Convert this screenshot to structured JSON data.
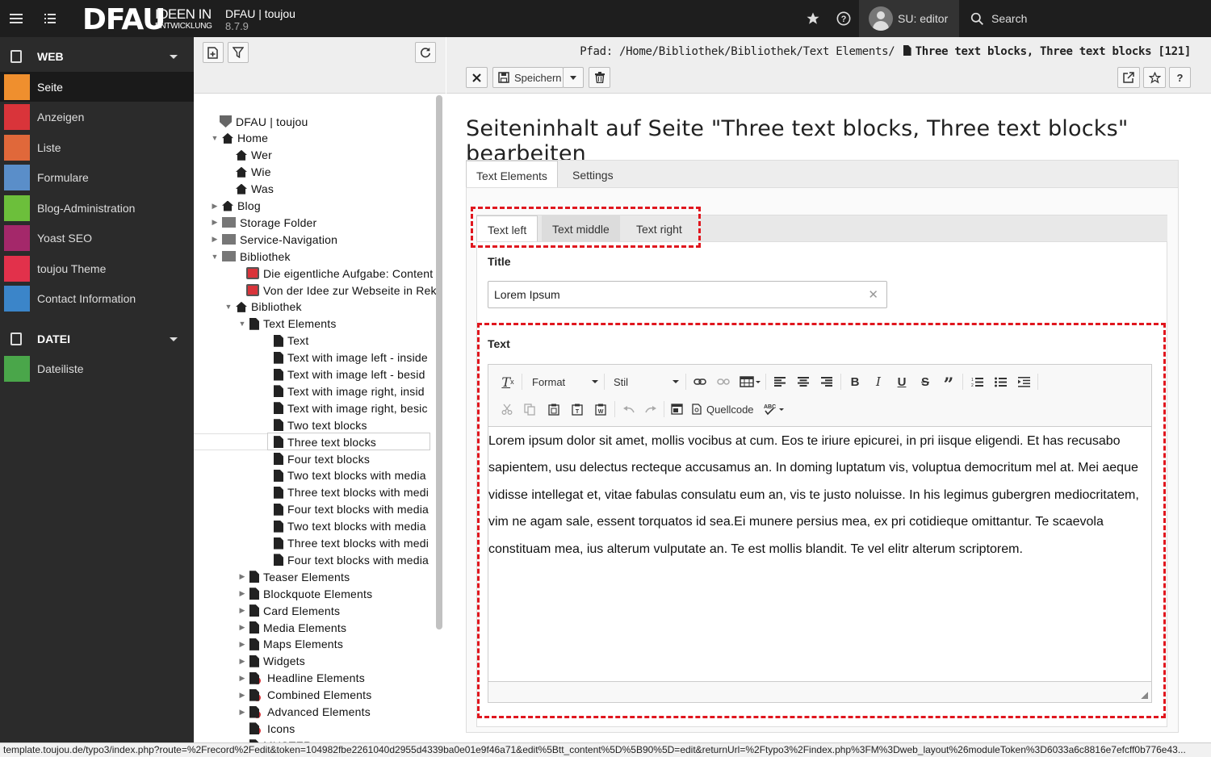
{
  "topbar": {
    "logo_main": "DFAU",
    "logo_line1": "IDEEN IN",
    "logo_line2": "ENTWICKLUNG",
    "site_name": "DFAU | toujou",
    "version": "8.7.9",
    "user_label": "SU: editor",
    "search_label": "Search"
  },
  "sidebar": {
    "groups": [
      {
        "label": "WEB"
      },
      {
        "label": "DATEI"
      }
    ],
    "web_items": [
      {
        "label": "Seite",
        "color": "#ef8f2e"
      },
      {
        "label": "Anzeigen",
        "color": "#d9343a"
      },
      {
        "label": "Liste",
        "color": "#e0683a"
      },
      {
        "label": "Formulare",
        "color": "#5a8ec9"
      },
      {
        "label": "Blog-Administration",
        "color": "#6cbf3b"
      },
      {
        "label": "Yoast SEO",
        "color": "#a4286a"
      },
      {
        "label": "toujou Theme",
        "color": "#e2314b"
      },
      {
        "label": "Contact Information",
        "color": "#3b85c9"
      }
    ],
    "datei_items": [
      {
        "label": "Dateiliste",
        "color": "#4aa64a"
      }
    ]
  },
  "tree": {
    "nodes": [
      {
        "label": "DFAU | toujou",
        "icon": "typo3-root-icon"
      },
      {
        "label": "Home",
        "icon": "home-icon"
      },
      {
        "label": "Wer",
        "icon": "home-icon"
      },
      {
        "label": "Wie",
        "icon": "home-icon"
      },
      {
        "label": "Was",
        "icon": "home-icon"
      },
      {
        "label": "Blog",
        "icon": "home-icon"
      },
      {
        "label": "Storage Folder",
        "icon": "folder-icon"
      },
      {
        "label": "Service-Navigation",
        "icon": "folder-icon"
      },
      {
        "label": "Bibliothek",
        "icon": "folder-icon"
      },
      {
        "label": "Die eigentliche Aufgabe: Content",
        "icon": "shortcut-icon"
      },
      {
        "label": "Von der Idee zur Webseite in Rek",
        "icon": "shortcut-icon"
      },
      {
        "label": "Bibliothek",
        "icon": "home-icon"
      },
      {
        "label": "Text Elements",
        "icon": "page-icon"
      },
      {
        "label": "Text",
        "icon": "page-icon"
      },
      {
        "label": "Text with image left - inside",
        "icon": "page-icon"
      },
      {
        "label": "Text with image left - besid",
        "icon": "page-icon"
      },
      {
        "label": "Text with image right, insid",
        "icon": "page-icon"
      },
      {
        "label": "Text with image right, besic",
        "icon": "page-icon"
      },
      {
        "label": "Two text blocks",
        "icon": "page-icon"
      },
      {
        "label": "Three text blocks",
        "icon": "page-icon"
      },
      {
        "label": "Four text blocks",
        "icon": "page-icon"
      },
      {
        "label": "Two text blocks with media",
        "icon": "page-icon"
      },
      {
        "label": "Three text blocks with medi",
        "icon": "page-icon"
      },
      {
        "label": "Four text blocks with media",
        "icon": "page-icon"
      },
      {
        "label": "Two text blocks with media",
        "icon": "page-icon"
      },
      {
        "label": "Three text blocks with medi",
        "icon": "page-icon"
      },
      {
        "label": "Four text blocks with media",
        "icon": "page-icon"
      },
      {
        "label": "Teaser Elements",
        "icon": "page-icon"
      },
      {
        "label": "Blockquote Elements",
        "icon": "page-icon"
      },
      {
        "label": "Card Elements",
        "icon": "page-icon"
      },
      {
        "label": "Media Elements",
        "icon": "page-icon"
      },
      {
        "label": "Maps Elements",
        "icon": "page-icon"
      },
      {
        "label": "Widgets",
        "icon": "page-icon"
      },
      {
        "label": "Headline Elements",
        "icon": "hidden-page-icon"
      },
      {
        "label": "Combined Elements",
        "icon": "hidden-page-icon"
      },
      {
        "label": "Advanced Elements",
        "icon": "hidden-page-icon"
      },
      {
        "label": "Icons",
        "icon": "hidden-page-icon"
      },
      {
        "label": "MUSTER",
        "icon": "page-icon"
      }
    ]
  },
  "doc": {
    "path_prefix": "Pfad: /Home/Bibliothek/Bibliothek/Text Elements/",
    "path_current": "Three text blocks, Three text blocks [121]",
    "save_label": "Speichern",
    "heading": "Seiteninhalt auf Seite \"Three text blocks, Three text blocks\" bearbeiten",
    "outer_tabs": [
      "Text Elements",
      "Settings"
    ],
    "inner_tabs": [
      "Text left",
      "Text middle",
      "Text right"
    ],
    "title_label": "Title",
    "title_value": "Lorem Ipsum",
    "text_label": "Text",
    "rte": {
      "format_label": "Format",
      "style_label": "Stil",
      "source_label": "Quellcode",
      "content": "Lorem ipsum dolor sit amet, mollis vocibus at cum. Eos te iriure epicurei, in pri iisque eligendi. Et has recusabo sapientem, usu delectus recteque accusamus an. In doming luptatum vis, voluptua democritum mel at. Mei aeque vidisse intellegat et, vitae fabulas consulatu eum an, vis te justo noluisse. In his legimus gubergren mediocritatem, vim ne agam sale, essent torquatos id sea.Ei munere persius mea, ex pri cotidieque omittantur. Te scaevola constituam mea, ius alterum vulputate an. Te est mollis blandit. Te vel elitr alterum scriptorem."
    }
  },
  "statusbar": {
    "url": "template.toujou.de/typo3/index.php?route=%2Frecord%2Fedit&token=104982fbe2261040d2955d4339ba0e01e9f46a71&edit%5Btt_content%5D%5B90%5D=edit&returnUrl=%2Ftypo3%2Findex.php%3FM%3Dweb_layout%26moduleToken%3D6033a6c8816e7efcff0b776e43..."
  }
}
